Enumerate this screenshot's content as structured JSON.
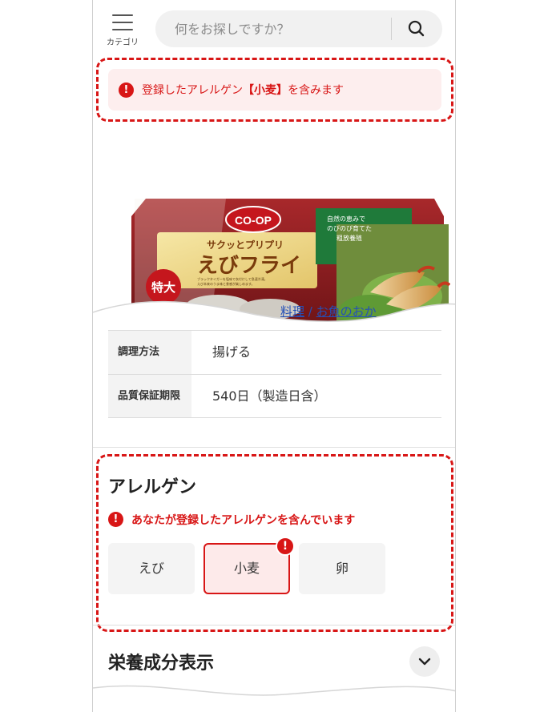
{
  "header": {
    "menu_label": "カテゴリ",
    "search_placeholder": "何をお探しですか？"
  },
  "top_alert": {
    "prefix": "登録したアレルゲン",
    "allergen": "【小麦】",
    "suffix": "を含みます"
  },
  "product_image": {
    "brand": "CO-OP",
    "tagline": "サクッとプリプリ",
    "name": "えびフライ",
    "size_badge": "特大",
    "side_text": [
      "自然の恵みで",
      "のびのび育てた",
      "粗放養殖"
    ],
    "small_print": [
      "ブラックタイガーを塩味で衣付けして急速冷凍。",
      "えび本来のうま味と食感が楽しめます。"
    ]
  },
  "breadcrumb_fragment": {
    "first": "料理",
    "separator": " / ",
    "second": "お魚のおか"
  },
  "spec_table": [
    {
      "key": "調理方法",
      "value": "揚げる"
    },
    {
      "key": "品質保証期限",
      "value": "540日（製造日含）"
    }
  ],
  "allergen_section": {
    "title": "アレルゲン",
    "warning": "あなたが登録したアレルゲンを含んでいます",
    "chips": [
      {
        "label": "えび",
        "registered": false
      },
      {
        "label": "小麦",
        "registered": true
      },
      {
        "label": "卵",
        "registered": false
      }
    ]
  },
  "nutrition_section": {
    "title": "栄養成分表示"
  },
  "colors": {
    "alert_red": "#d81616",
    "alert_bg": "#fdeeee",
    "link_blue": "#2450b8"
  },
  "icons": {
    "menu": "hamburger-icon",
    "search": "search-icon",
    "alert": "exclamation-icon",
    "expand": "chevron-down-icon"
  }
}
